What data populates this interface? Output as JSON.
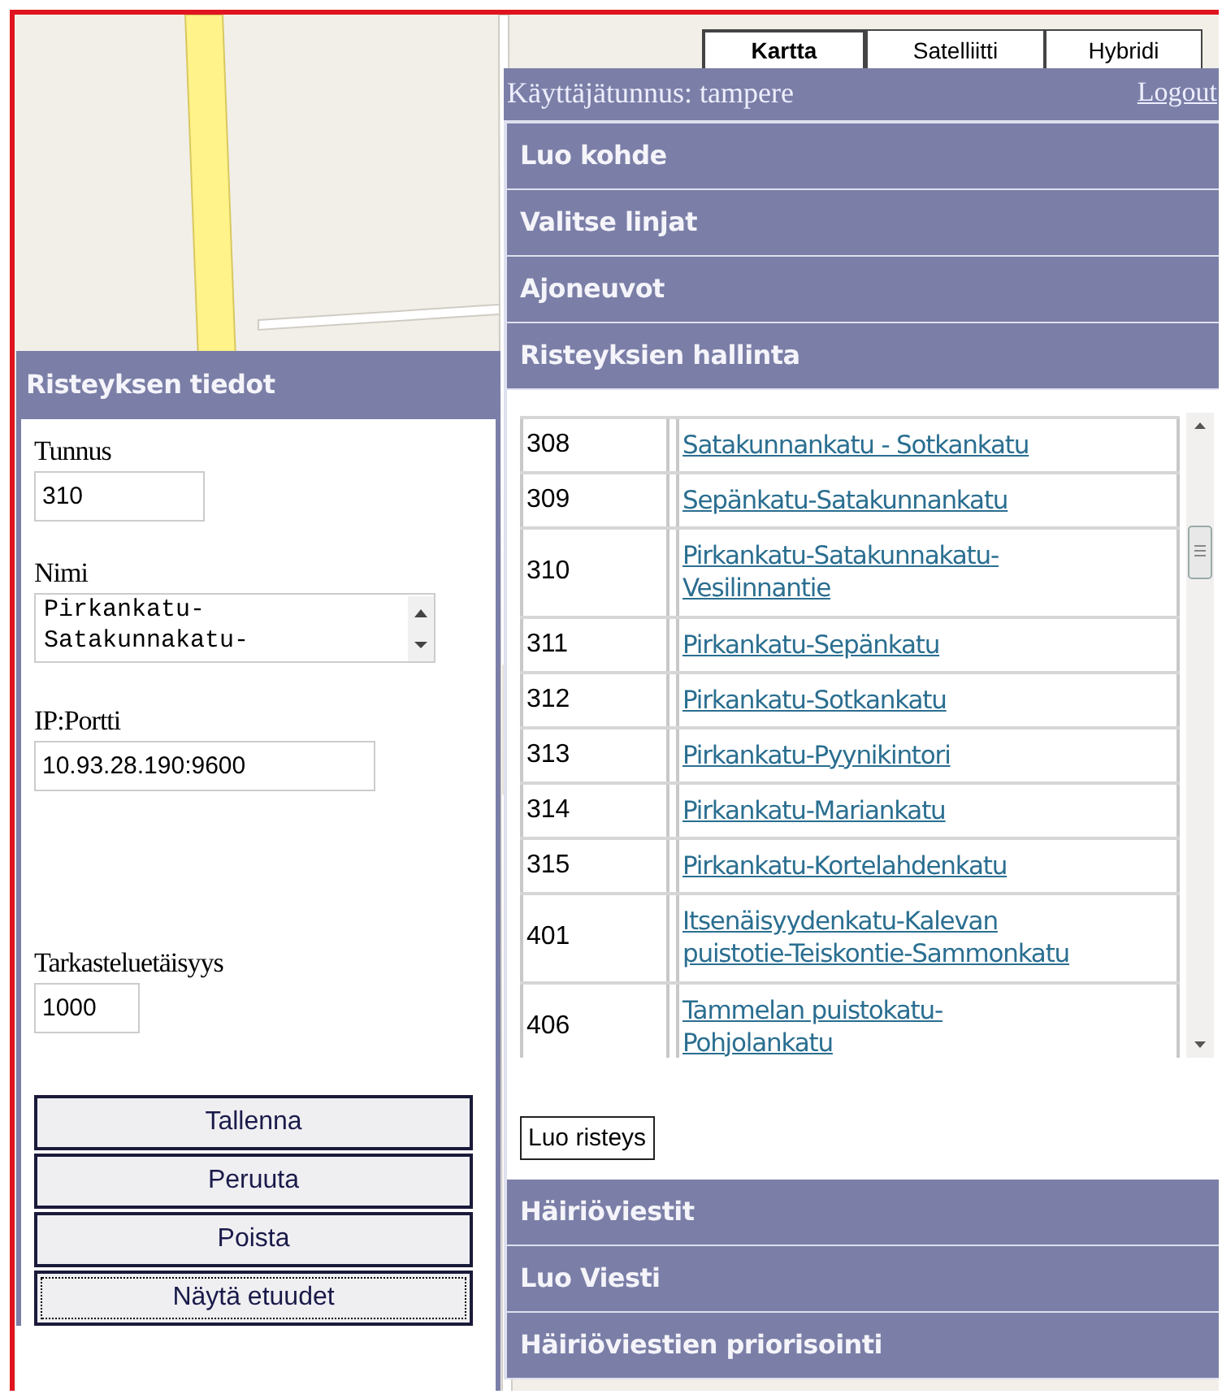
{
  "map": {
    "types": [
      {
        "label": "Kartta",
        "selected": true
      },
      {
        "label": "Satelliitti",
        "selected": false
      },
      {
        "label": "Hybridi",
        "selected": false
      }
    ]
  },
  "user_bar": {
    "username": "Käyttäjätunnus: tampere",
    "logout": "Logout"
  },
  "accordion_top": [
    "Luo kohde",
    "Valitse linjat",
    "Ajoneuvot"
  ],
  "active_section": {
    "title": "Risteyksien hallinta",
    "rows": [
      {
        "id": "308",
        "name": "Satakunnankatu - Sotkankatu"
      },
      {
        "id": "309",
        "name": "Sepänkatu-Satakunnankatu"
      },
      {
        "id": "310",
        "name": "Pirkankatu-Satakunnakatu-\nVesilinnantie"
      },
      {
        "id": "311",
        "name": "Pirkankatu-Sepänkatu"
      },
      {
        "id": "312",
        "name": "Pirkankatu-Sotkankatu"
      },
      {
        "id": "313",
        "name": "Pirkankatu-Pyynikintori"
      },
      {
        "id": "314",
        "name": "Pirkankatu-Mariankatu"
      },
      {
        "id": "315",
        "name": "Pirkankatu-Kortelahdenkatu"
      },
      {
        "id": "401",
        "name": "Itsenäisyydenkatu-Kalevan\npuistotie-Teiskontie-Sammonkatu"
      },
      {
        "id": "406",
        "name": "Tammelan puistokatu-\nPohjolankatu"
      }
    ],
    "create_button": "Luo risteys"
  },
  "accordion_bottom": [
    "Häiriöviestit",
    "Luo Viesti",
    "Häiriöviestien priorisointi"
  ],
  "detail_panel": {
    "title": "Risteyksen tiedot",
    "fields": [
      {
        "label": "Tunnus",
        "kind": "text",
        "value": "310"
      },
      {
        "label": "Nimi",
        "kind": "textarea",
        "lines": [
          "Pirkankatu-",
          "Satakunnakatu-"
        ]
      },
      {
        "label": "IP:Portti",
        "kind": "text",
        "value": "10.93.28.190:9600"
      },
      {
        "label": "Tarkasteluetäisyys",
        "kind": "text",
        "value": "1000"
      }
    ],
    "buttons": [
      {
        "label": "Tallenna",
        "focused": false
      },
      {
        "label": "Peruuta",
        "focused": false
      },
      {
        "label": "Poista",
        "focused": false
      },
      {
        "label": "Näytä etuudet",
        "focused": true
      }
    ]
  }
}
